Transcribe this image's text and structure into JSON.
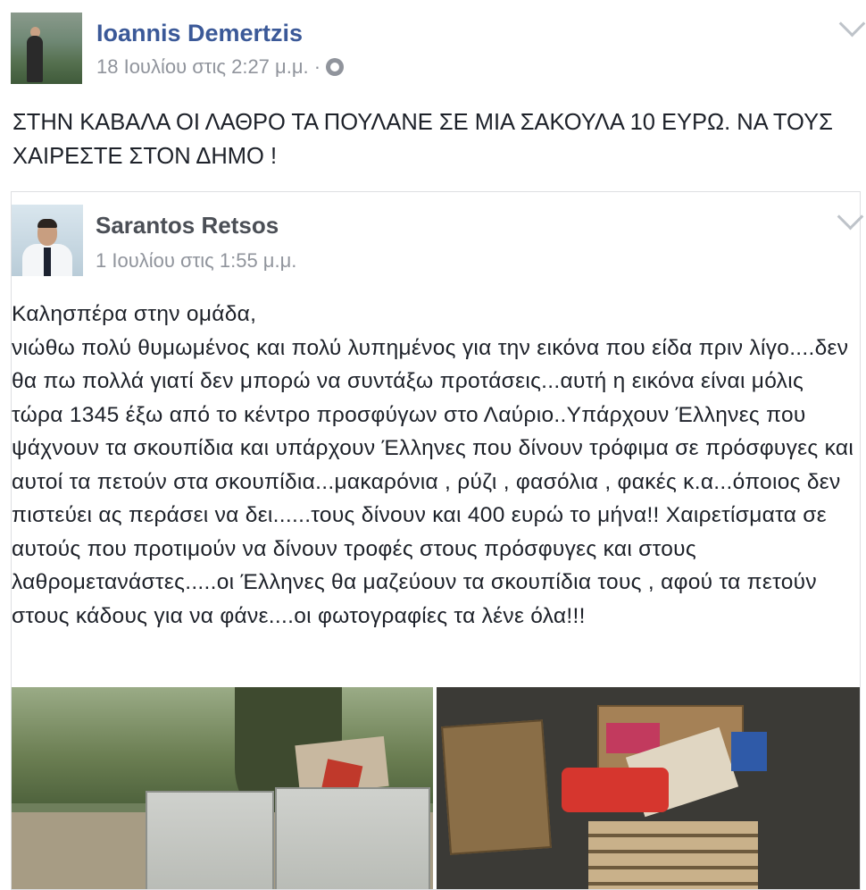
{
  "post": {
    "author": "Ioannis Demertzis",
    "timestamp": "18 Ιουλίου στις 2:27 μ.μ. ·",
    "privacy_icon": "globe-icon",
    "text": "ΣΤΗΝ ΚΑΒΑΛΑ ΟΙ ΛΑΘΡΟ ΤΑ ΠΟΥΛΑΝΕ ΣΕ ΜΙΑ ΣΑΚΟΥΛΑ 10 ΕΥΡΩ. ΝΑ ΤΟΥΣ ΧΑΙΡΕΣΤΕ ΣΤΟΝ ΔΗΜΟ !"
  },
  "shared_post": {
    "author": "Sarantos Retsos",
    "timestamp": "1 Ιουλίου στις 1:55 μ.μ.",
    "greeting": "Καλησπέρα στην ομάδα,",
    "body": "νιώθω πολύ θυμωμένος και πολύ λυπημένος για την εικόνα που είδα πριν λίγο....δεν θα πω πολλά γιατί δεν μπορώ να συντάξω προτάσεις...αυτή η εικόνα είναι μόλις τώρα 1345 έξω από το κέντρο προσφύγων στο Λαύριο..Υπάρχουν Έλληνες που ψάχνουν τα σκουπίδια και υπάρχουν Έλληνες που δίνουν τρόφιμα σε πρόσφυγες και αυτοί τα πετούν στα σκουπίδια...μακαρόνια , ρύζι , φασόλια , φακές κ.α...όποιος δεν πιστεύει ας περάσει να δει......τους δίνουν και 400 ευρώ το μήνα!! Χαιρετίσματα σε αυτούς που προτιμούν να δίνουν τροφές στους πρόσφυγες και στους λαθρομετανάστες.....οι Έλληνες θα μαζεύουν τα σκουπίδια τους , αφού τα πετούν στους κάδους για να φάνε....οι φωτογραφίες τα λένε όλα!!!"
  },
  "colors": {
    "link": "#3b5998",
    "meta": "#90949c",
    "text": "#1d2129",
    "border": "#dddfe2"
  }
}
